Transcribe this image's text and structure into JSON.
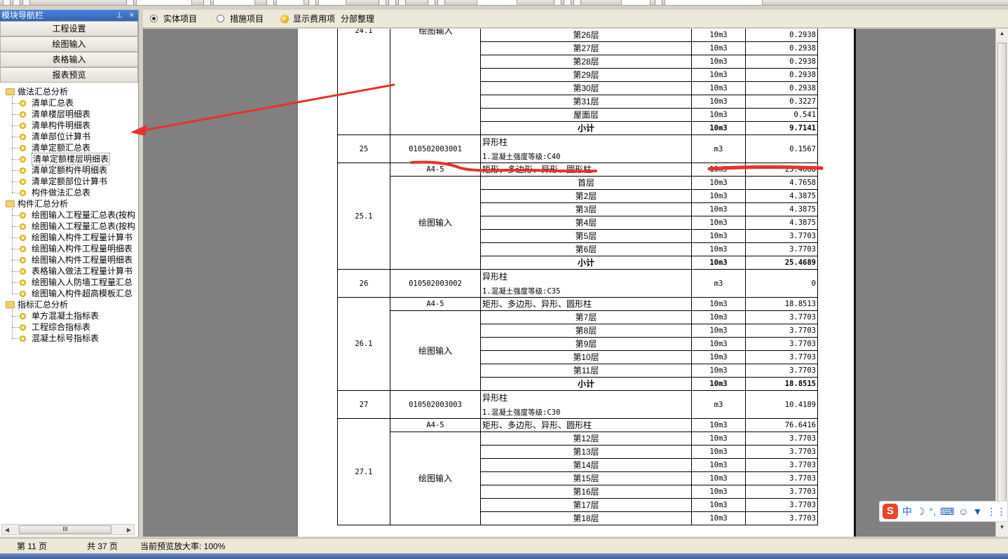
{
  "nav": {
    "title": "模块导航栏",
    "pin_icon": "pin-icon",
    "close_icon": "close-icon",
    "modules": [
      "工程设置",
      "绘图输入",
      "表格输入",
      "报表预览"
    ],
    "tree": [
      {
        "label": "做法汇总分析",
        "type": "folder",
        "children": [
          "清单汇总表",
          "清单楼层明细表",
          "清单构件明细表",
          "清单部位计算书",
          "清单定额汇总表",
          "清单定额楼层明细表",
          "清单定额构件明细表",
          "清单定额部位计算书",
          "构件做法汇总表"
        ]
      },
      {
        "label": "构件汇总分析",
        "type": "folder",
        "children": [
          "绘图输入工程量汇总表(按构",
          "绘图输入工程量汇总表(按构",
          "绘图输入构件工程量计算书",
          "绘图输入构件工程量明细表",
          "绘图输入构件工程量明细表",
          "表格输入做法工程量计算书",
          "绘图输入人防墙工程量汇总",
          "绘图输入构件超高模板汇总"
        ]
      },
      {
        "label": "指标汇总分析",
        "type": "folder",
        "children": [
          "单方混凝土指标表",
          "工程综合指标表",
          "混凝土标号指标表"
        ]
      }
    ],
    "selected": "清单定额楼层明细表",
    "hscroll_grip": "III"
  },
  "options": {
    "radio1": "实体项目",
    "radio1_checked": true,
    "radio2": "措施项目",
    "radio2_checked": false,
    "show_fee": "显示费用项",
    "section_sort": "分部整理"
  },
  "table_rows": [
    {
      "id": "",
      "code": "",
      "desc": "第26层",
      "unit": "10m3",
      "qty": "0.2938"
    },
    {
      "id": "",
      "code": "",
      "desc": "第27层",
      "unit": "10m3",
      "qty": "0.2938"
    },
    {
      "id": "",
      "code": "",
      "desc": "第28层",
      "unit": "10m3",
      "qty": "0.2938"
    },
    {
      "id": "",
      "code": "",
      "desc": "第29层",
      "unit": "10m3",
      "qty": "0.2938"
    },
    {
      "id": "",
      "code": "",
      "desc": "第30层",
      "unit": "10m3",
      "qty": "0.2938"
    },
    {
      "id": "",
      "code": "",
      "desc": "第31层",
      "unit": "10m3",
      "qty": "0.3227"
    },
    {
      "id": "",
      "code": "",
      "desc": "屋面层",
      "unit": "10m3",
      "qty": "0.541"
    },
    {
      "id": "",
      "code": "",
      "desc": "小计",
      "unit": "10m3",
      "qty": "9.7141",
      "bold": true
    }
  ],
  "table": {
    "g24_id": "24.1",
    "g24_code": "绘图输入",
    "g25_id": "25",
    "g25_code": "010502003001",
    "g25_name": "异形柱",
    "g25_spec": "1.混凝土强度等级:C40",
    "g25_unit": "m3",
    "g25_qty": "0.1567",
    "g251_quota": "A4-5",
    "g251_desc": "矩形、多边形、异形、圆形柱",
    "g251_unit": "10m3",
    "g251_qty": "25.4688",
    "g251_id": "25.1",
    "g251_src": "绘图输入",
    "g251_floors": [
      {
        "f": "首层",
        "q": "4.7658"
      },
      {
        "f": "第2层",
        "q": "4.3875"
      },
      {
        "f": "第3层",
        "q": "4.3875"
      },
      {
        "f": "第4层",
        "q": "4.3875"
      },
      {
        "f": "第5层",
        "q": "3.7703"
      },
      {
        "f": "第6层",
        "q": "3.7703"
      }
    ],
    "g251_sub_label": "小计",
    "g251_sub": "25.4689",
    "g26_id": "26",
    "g26_code": "010502003002",
    "g26_name": "异形柱",
    "g26_spec": "1.混凝土强度等级:C35",
    "g26_unit": "m3",
    "g26_qty": "0",
    "g261_quota": "A4-5",
    "g261_desc": "矩形、多边形、异形、圆形柱",
    "g261_unit": "10m3",
    "g261_qty": "18.8513",
    "g261_id": "26.1",
    "g261_src": "绘图输入",
    "g261_floors": [
      {
        "f": "第7层",
        "q": "3.7703"
      },
      {
        "f": "第8层",
        "q": "3.7703"
      },
      {
        "f": "第9层",
        "q": "3.7703"
      },
      {
        "f": "第10层",
        "q": "3.7703"
      },
      {
        "f": "第11层",
        "q": "3.7703"
      }
    ],
    "g261_sub_label": "小计",
    "g261_sub": "18.8515",
    "g27_id": "27",
    "g27_code": "010502003003",
    "g27_name": "异形柱",
    "g27_spec": "1.混凝土强度等级:C30",
    "g27_unit": "m3",
    "g27_qty": "10.4189",
    "g271_quota": "A4-5",
    "g271_desc": "矩形、多边形、异形、圆形柱",
    "g271_unit": "10m3",
    "g271_qty": "76.6416",
    "g271_id": "27.1",
    "g271_src": "绘图输入",
    "g271_floors": [
      {
        "f": "第12层",
        "q": "3.7703"
      },
      {
        "f": "第13层",
        "q": "3.7703"
      },
      {
        "f": "第14层",
        "q": "3.7703"
      },
      {
        "f": "第15层",
        "q": "3.7703"
      },
      {
        "f": "第16层",
        "q": "3.7703"
      },
      {
        "f": "第17层",
        "q": "3.7703"
      },
      {
        "f": "第18层",
        "q": "3.7703"
      }
    ],
    "unit_10m3": "10m3"
  },
  "status": {
    "page_current": "第 11 页",
    "page_total": "共 37 页",
    "zoom": "当前预览放大率: 100%"
  },
  "ime": {
    "logo": "S",
    "mode": "中",
    "icons": [
      "moon-icon",
      "punct-icon",
      "keyboard-icon",
      "user-icon",
      "shirt-icon",
      "grid-icon"
    ]
  },
  "annotation_color": "#e8312a"
}
